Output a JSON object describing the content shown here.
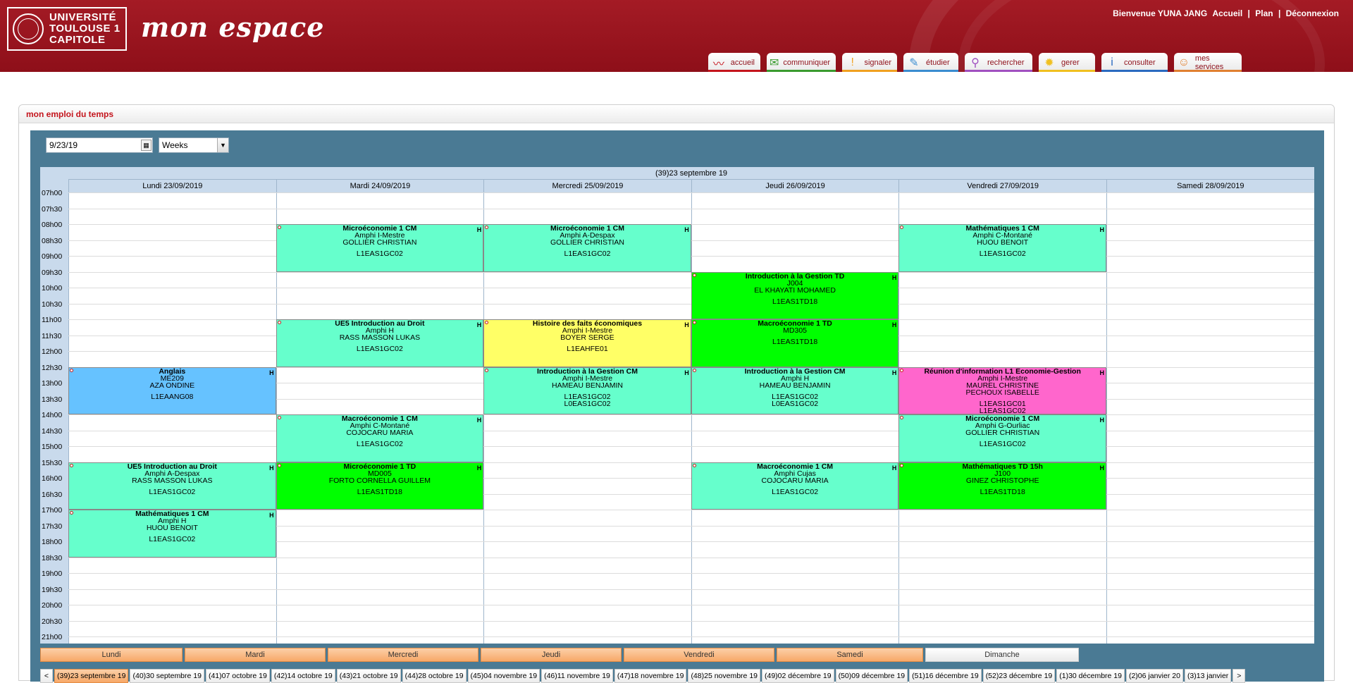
{
  "header": {
    "logo_lines": [
      "UNIVERSITÉ",
      "TOULOUSE 1",
      "CAPITOLE"
    ],
    "brand": "mon espace",
    "welcome": "Bienvenue YUNA JANG",
    "links": [
      "Accueil",
      "|",
      "Plan",
      "|",
      "Déconnexion"
    ]
  },
  "nav": [
    {
      "label": "accueil",
      "icon": "chart-icon",
      "glyph": "〰",
      "color": "#c4141c"
    },
    {
      "label": "communiquer",
      "icon": "chat-icon",
      "glyph": "✉",
      "color": "#3a9b2e"
    },
    {
      "label": "signaler",
      "icon": "warning-icon",
      "glyph": "!",
      "color": "#f0a020"
    },
    {
      "label": "étudier",
      "icon": "pencil-icon",
      "glyph": "✎",
      "color": "#3a8cd0"
    },
    {
      "label": "rechercher",
      "icon": "magnifier-icon",
      "glyph": "⚲",
      "color": "#a050c0"
    },
    {
      "label": "gerer",
      "icon": "gear-icon",
      "glyph": "✹",
      "color": "#f0c020"
    },
    {
      "label": "consulter",
      "icon": "info-icon",
      "glyph": "i",
      "color": "#2a6ac0"
    },
    {
      "label": "mes services",
      "icon": "user-icon",
      "glyph": "☺",
      "color": "#e08030"
    }
  ],
  "panel": {
    "title": "mon emploi du temps"
  },
  "toolbar": {
    "date": "9/23/19",
    "view": "Weeks"
  },
  "calendar": {
    "week_title": "(39)23 septembre 19",
    "days": [
      "Lundi 23/09/2019",
      "Mardi 24/09/2019",
      "Mercredi 25/09/2019",
      "Jeudi 26/09/2019",
      "Vendredi 27/09/2019",
      "Samedi 28/09/2019"
    ],
    "times": [
      "07h00",
      "07h30",
      "08h00",
      "08h30",
      "09h00",
      "09h30",
      "10h00",
      "10h30",
      "11h00",
      "11h30",
      "12h00",
      "12h30",
      "13h00",
      "13h30",
      "14h00",
      "14h30",
      "15h00",
      "15h30",
      "16h00",
      "16h30",
      "17h00",
      "17h30",
      "18h00",
      "18h30",
      "19h00",
      "19h30",
      "20h00",
      "20h30",
      "21h00"
    ],
    "events": [
      {
        "day": 0,
        "start": 11,
        "end": 14,
        "color": "#66c2ff",
        "lines": [
          "Anglais",
          "ME209",
          "AZA ONDINE"
        ],
        "group": "L1EAANG08"
      },
      {
        "day": 0,
        "start": 17,
        "end": 20,
        "color": "#66ffcc",
        "lines": [
          "UE5 Introduction au Droit",
          "Amphi A-Despax",
          "RASS MASSON LUKAS"
        ],
        "group": "L1EAS1GC02"
      },
      {
        "day": 0,
        "start": 20,
        "end": 23,
        "color": "#66ffcc",
        "lines": [
          "Mathématiques 1 CM",
          "Amphi H",
          "HUOU BENOIT"
        ],
        "group": "L1EAS1GC02"
      },
      {
        "day": 1,
        "start": 2,
        "end": 5,
        "color": "#66ffcc",
        "lines": [
          "Microéconomie 1 CM",
          "Amphi I-Mestre",
          "GOLLIER CHRISTIAN"
        ],
        "group": "L1EAS1GC02"
      },
      {
        "day": 1,
        "start": 8,
        "end": 11,
        "color": "#66ffcc",
        "lines": [
          "UE5 Introduction au Droit",
          "Amphi H",
          "RASS MASSON LUKAS"
        ],
        "group": "L1EAS1GC02"
      },
      {
        "day": 1,
        "start": 14,
        "end": 17,
        "color": "#66ffcc",
        "lines": [
          "Macroéconomie 1 CM",
          "Amphi C-Montané",
          "COJOCARU MARIA"
        ],
        "group": "L1EAS1GC02"
      },
      {
        "day": 1,
        "start": 17,
        "end": 20,
        "color": "#00ff00",
        "lines": [
          "Microéconomie 1 TD",
          "MD005",
          "FORTO CORNELLA GUILLEM"
        ],
        "group": "L1EAS1TD18"
      },
      {
        "day": 2,
        "start": 2,
        "end": 5,
        "color": "#66ffcc",
        "lines": [
          "Microéconomie 1 CM",
          "Amphi A-Despax",
          "GOLLIER CHRISTIAN"
        ],
        "group": "L1EAS1GC02"
      },
      {
        "day": 2,
        "start": 8,
        "end": 11,
        "color": "#ffff66",
        "lines": [
          "Histoire des faits économiques",
          "Amphi I-Mestre",
          "BOYER SERGE"
        ],
        "group": "L1EAHFE01"
      },
      {
        "day": 2,
        "start": 11,
        "end": 14,
        "color": "#66ffcc",
        "lines": [
          "Introduction à la Gestion CM",
          "Amphi I-Mestre",
          "HAMEAU BENJAMIN"
        ],
        "group": "L1EAS1GC02 L0EAS1GC02"
      },
      {
        "day": 3,
        "start": 5,
        "end": 8,
        "color": "#00ff00",
        "lines": [
          "Introduction à la Gestion TD",
          "J004",
          "EL KHAYATI MOHAMED"
        ],
        "group": "L1EAS1TD18"
      },
      {
        "day": 3,
        "start": 8,
        "end": 11,
        "color": "#00ff00",
        "lines": [
          "Macroéconomie 1 TD",
          "MD305",
          ""
        ],
        "group": "L1EAS1TD18"
      },
      {
        "day": 3,
        "start": 11,
        "end": 14,
        "color": "#66ffcc",
        "lines": [
          "Introduction à la Gestion CM",
          "Amphi H",
          "HAMEAU BENJAMIN"
        ],
        "group": "L1EAS1GC02 L0EAS1GC02"
      },
      {
        "day": 3,
        "start": 17,
        "end": 20,
        "color": "#66ffcc",
        "lines": [
          "Macroéconomie 1 CM",
          "Amphi Cujas",
          "COJOCARU MARIA"
        ],
        "group": "L1EAS1GC02"
      },
      {
        "day": 4,
        "start": 2,
        "end": 5,
        "color": "#66ffcc",
        "lines": [
          "Mathématiques 1 CM",
          "Amphi C-Montané",
          "HUOU BENOIT"
        ],
        "group": "L1EAS1GC02"
      },
      {
        "day": 4,
        "start": 11,
        "end": 14,
        "color": "#ff66cc",
        "lines": [
          "Réunion d'information L1 Economie-Gestion",
          "Amphi I-Mestre",
          "MAUREL CHRISTINE",
          "PECHOUX ISABELLE"
        ],
        "group": "L1EAS1GC01 L1EAS1GC02"
      },
      {
        "day": 4,
        "start": 14,
        "end": 17,
        "color": "#66ffcc",
        "lines": [
          "Microéconomie 1 CM",
          "Amphi G-Ourliac",
          "GOLLIER CHRISTIAN"
        ],
        "group": "L1EAS1GC02"
      },
      {
        "day": 4,
        "start": 17,
        "end": 20,
        "color": "#00ff00",
        "lines": [
          "Mathématiques TD 15h",
          "J100",
          "GINEZ CHRISTOPHE"
        ],
        "group": "L1EAS1TD18"
      }
    ]
  },
  "day_tabs": [
    {
      "label": "Lundi",
      "active": true
    },
    {
      "label": "Mardi",
      "active": true
    },
    {
      "label": "Mercredi",
      "active": true
    },
    {
      "label": "Jeudi",
      "active": true
    },
    {
      "label": "Vendredi",
      "active": true
    },
    {
      "label": "Samedi",
      "active": true
    },
    {
      "label": "Dimanche",
      "active": false
    }
  ],
  "weeks": [
    "(39)23 septembre 19",
    "(40)30 septembre 19",
    "(41)07 octobre 19",
    "(42)14 octobre 19",
    "(43)21 octobre 19",
    "(44)28 octobre 19",
    "(45)04 novembre 19",
    "(46)11 novembre 19",
    "(47)18 novembre 19",
    "(48)25 novembre 19",
    "(49)02 décembre 19",
    "(50)09 décembre 19",
    "(51)16 décembre 19",
    "(52)23 décembre 19",
    "(1)30 décembre 19",
    "(2)06 janvier 20",
    "(3)13 janvier"
  ],
  "week_nav": {
    "prev": "<",
    "next": ">"
  }
}
